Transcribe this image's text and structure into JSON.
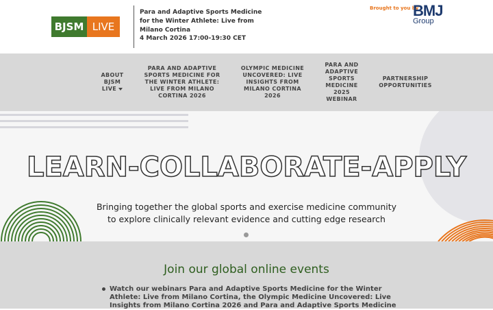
{
  "header": {
    "logo_left": "BJSM",
    "logo_right": "LIVE",
    "event_title": "Para and Adaptive Sports Medicine for the Winter Athlete: Live from Milano Cortina",
    "event_date": "4 March 2026 17:00-19:30 CET",
    "brought_by": "Brought to you by",
    "bmj_name": "BMJ",
    "bmj_group": "Group"
  },
  "nav": {
    "items": [
      {
        "label": "ABOUT BJSM LIVE"
      },
      {
        "label": "PARA AND ADAPTIVE SPORTS MEDICINE FOR THE WINTER ATHLETE: LIVE FROM MILANO CORTINA 2026"
      },
      {
        "label": "OLYMPIC MEDICINE UNCOVERED: LIVE INSIGHTS FROM MILANO CORTINA 2026"
      },
      {
        "label": "PARA AND ADAPTIVE SPORTS MEDICINE 2025 WEBINAR"
      },
      {
        "label": "PARTNERSHIP OPPORTUNITIES"
      }
    ]
  },
  "hero": {
    "headline": "LEARN-COLLABORATE-APPLY",
    "subtext_line1": "Bringing together the global sports and exercise medicine community",
    "subtext_line2": "to explore clinically relevant evidence and cutting edge research"
  },
  "join": {
    "title": "Join our global online events",
    "bullet": "Watch our webinars Para and Adaptive Sports Medicine for the Winter Athlete: Live from Milano Cortina, the Olympic Medicine Uncovered: Live Insights from Milano Cortina 2026 and Para and Adaptive Sports Medicine"
  },
  "colors": {
    "brand_green": "#3f7a2e",
    "brand_orange": "#e8761e",
    "bmj_blue": "#1d3a6e",
    "nav_bg": "#d8d8d8"
  }
}
